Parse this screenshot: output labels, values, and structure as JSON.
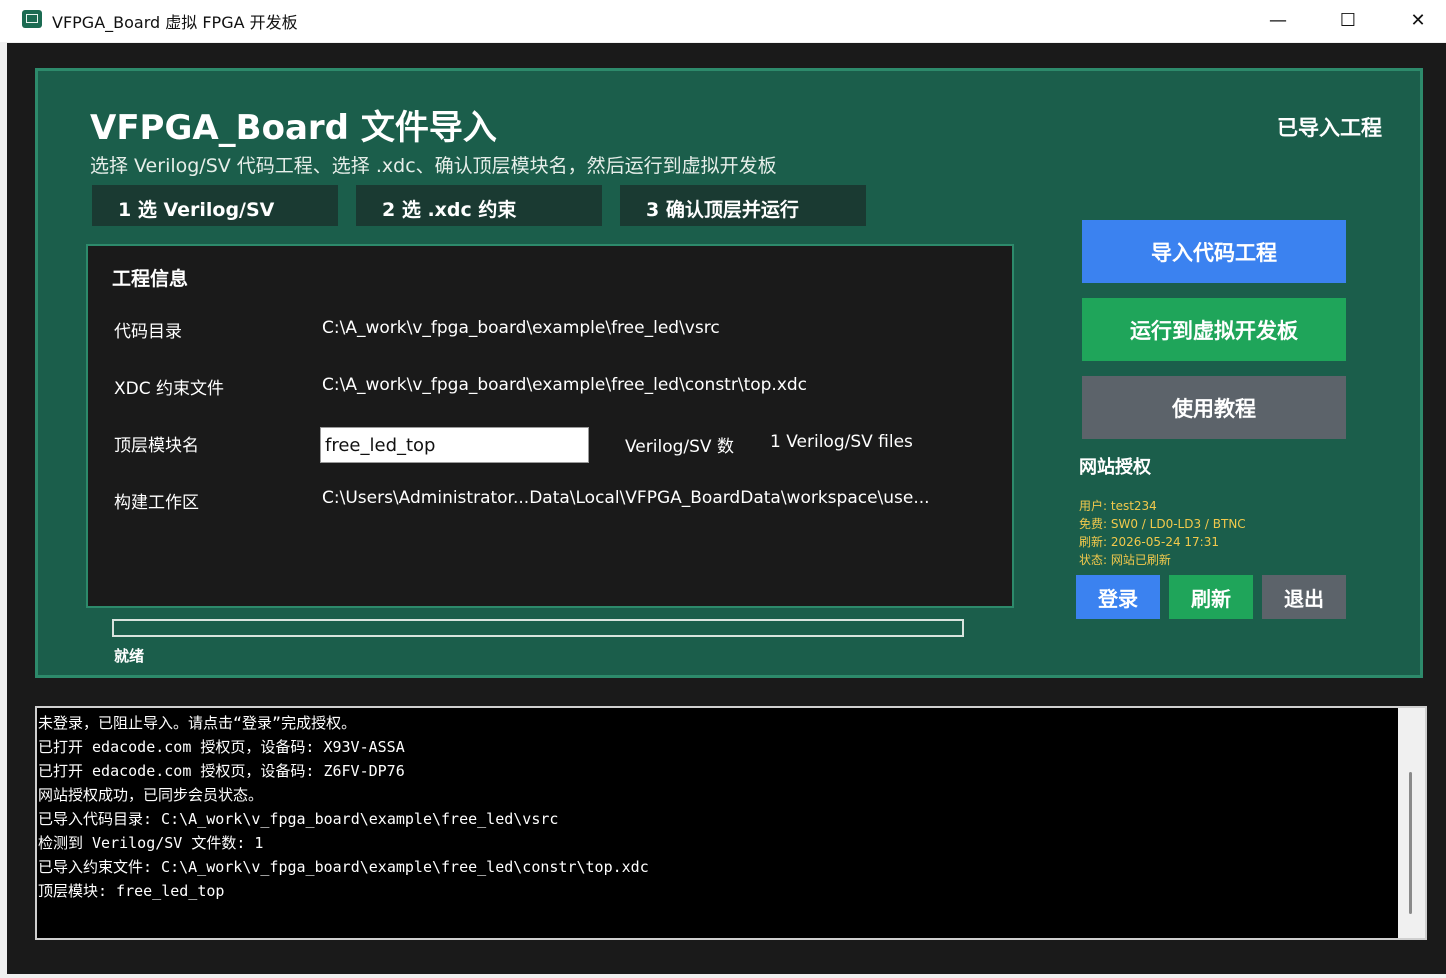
{
  "window": {
    "title": "VFPGA_Board 虚拟 FPGA 开发板",
    "minimize_glyph": "—",
    "maximize_glyph": "☐",
    "close_glyph": "✕"
  },
  "header": {
    "title": "VFPGA_Board 文件导入",
    "subtitle": "选择 Verilog/SV 代码工程、选择 .xdc、确认顶层模块名，然后运行到虚拟开发板",
    "status": "已导入工程"
  },
  "steps": [
    {
      "label": "1  选 Verilog/SV"
    },
    {
      "label": "2  选 .xdc 约束"
    },
    {
      "label": "3  确认顶层并运行"
    }
  ],
  "project_info": {
    "title": "工程信息",
    "code_dir_label": "代码目录",
    "code_dir_value": "C:\\A_work\\v_fpga_board\\example\\free_led\\vsrc",
    "xdc_label": "XDC 约束文件",
    "xdc_value": "C:\\A_work\\v_fpga_board\\example\\free_led\\constr\\top.xdc",
    "top_label": "顶层模块名",
    "top_value": "free_led_top",
    "count_label": "Verilog/SV 数",
    "count_value": "1 Verilog/SV files",
    "workspace_label": "构建工作区",
    "workspace_value": "C:\\Users\\Administrator...Data\\Local\\VFPGA_BoardData\\workspace\\use..."
  },
  "progress": {
    "fraction": 0,
    "status": "就绪"
  },
  "actions": {
    "import": "导入代码工程",
    "run": "运行到虚拟开发板",
    "tutorial": "使用教程"
  },
  "auth": {
    "title": "网站授权",
    "user": "用户: test234",
    "free": "免费: SW0 / LD0-LD3 / BTNC",
    "refreshed": "刷新: 2026-05-24 17:31",
    "state": "状态: 网站已刷新",
    "login": "登录",
    "refresh": "刷新",
    "logout": "退出"
  },
  "console": {
    "lines": [
      "未登录，已阻止导入。请点击“登录”完成授权。",
      "已打开 edacode.com 授权页，设备码: X93V-ASSA",
      "已打开 edacode.com 授权页，设备码: Z6FV-DP76",
      "网站授权成功，已同步会员状态。",
      "已导入代码目录: C:\\A_work\\v_fpga_board\\example\\free_led\\vsrc",
      "检测到 Verilog/SV 文件数: 1",
      "已导入约束文件: C:\\A_work\\v_fpga_board\\example\\free_led\\constr\\top.xdc",
      "顶层模块: free_led_top"
    ]
  },
  "colors": {
    "panel_bg": "#1b5e4b",
    "panel_border": "#2d8a6b",
    "import_button": "#3b82f0",
    "run_button": "#1fa55a",
    "tutorial_button": "#5c636a",
    "auth_text": "#f2c94c",
    "logout_button": "#5c636a"
  }
}
